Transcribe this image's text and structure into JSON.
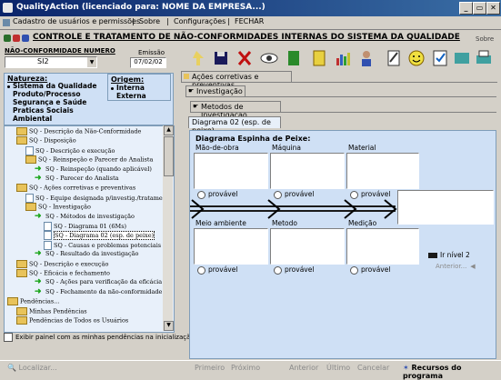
{
  "window": {
    "title": "QualityAction   (licenciado para: NOME DA EMPRESA...)",
    "controls": [
      "_",
      "▭",
      "✕"
    ]
  },
  "menubar": {
    "items": [
      "Cadastro de usuários e permissões",
      "Sobre",
      "Configurações",
      "FECHAR"
    ],
    "separators": [
      "|",
      "|",
      "|"
    ]
  },
  "banner": {
    "title": "CONTROLE E TRATAMENTO DE NÃO-CONFORMIDADES INTERNAS DO SISTEMA DA QUALIDADE",
    "sobre": "Sobre"
  },
  "nc": {
    "label": "NÃO-CONFORMIDADE  NUMERO",
    "number": "SI2",
    "emissao_label": "Emissão",
    "emissao_value": "07/02/02"
  },
  "natureza": {
    "label": "Natureza:",
    "options": [
      "Sistema da Qualidade",
      "Produto/Processo",
      "Segurança e Saúde",
      "Praticas Sociais",
      "Ambiental"
    ],
    "selected": "Sistema da Qualidade"
  },
  "origem": {
    "label": "Origem:",
    "options": [
      "Interna",
      "Externa"
    ],
    "selected": "Interna"
  },
  "tree": {
    "items": [
      {
        "text": "SQ - Descrição da Não-Conformidade",
        "kind": "folder",
        "indent": 1
      },
      {
        "text": "SQ - Disposição",
        "kind": "folder",
        "indent": 1
      },
      {
        "text": "SQ - Descrição e execução",
        "kind": "doc",
        "indent": 2
      },
      {
        "text": "SQ - Reinspeção e Parecer do Analista",
        "kind": "folder",
        "indent": 2
      },
      {
        "text": "SQ - Reinspeção (quando aplicável)",
        "kind": "arrow",
        "indent": 3
      },
      {
        "text": "SQ - Parecer do Analista",
        "kind": "arrow",
        "indent": 3
      },
      {
        "text": "SQ - Ações corretivas e preventivas",
        "kind": "folder",
        "indent": 1
      },
      {
        "text": "SQ - Equipe designada p/investig./tratamento",
        "kind": "doc",
        "indent": 2
      },
      {
        "text": "SQ - Investigação",
        "kind": "folder",
        "indent": 2
      },
      {
        "text": "SQ - Métodos de investigação",
        "kind": "arrow",
        "indent": 3
      },
      {
        "text": "SQ - Diagrama 01 (6Ms)",
        "kind": "doc",
        "indent": 4
      },
      {
        "text": "SQ - Diagrama 02 (esp. de peixe)",
        "kind": "doc",
        "indent": 4
      },
      {
        "text": "SQ - Causas e problemas potenciais",
        "kind": "doc",
        "indent": 4
      },
      {
        "text": "SQ - Resultado da investigação",
        "kind": "arrow",
        "indent": 3
      },
      {
        "text": "SQ - Descrição e execução",
        "kind": "folder",
        "indent": 1
      },
      {
        "text": "SQ - Eficácia e fechamento",
        "kind": "folder",
        "indent": 1
      },
      {
        "text": "SQ - Ações para verificação da eficácia",
        "kind": "arrow",
        "indent": 3
      },
      {
        "text": "SQ - Fechamento da não-conformidade",
        "kind": "arrow",
        "indent": 3
      },
      {
        "text": "Pendências...",
        "kind": "folder",
        "indent": 0
      },
      {
        "text": "Minhas Pendências",
        "kind": "folder",
        "indent": 1
      },
      {
        "text": "Pendências de Todos os Usuários",
        "kind": "folder",
        "indent": 1
      }
    ]
  },
  "exibir_painel": "Exibir painel com as minhas pendências na inicialização",
  "tabs": {
    "level1": "Ações corretivas e preventivas",
    "level2": "Investigação",
    "level3": "Metodos de Investigação",
    "level4": "Diagrama 02 (esp. de peixe)"
  },
  "diagram": {
    "title": "Diagrama Espinha de Peixe:",
    "top_labels": [
      "Mão-de-obra",
      "Máquina",
      "Material"
    ],
    "bottom_labels": [
      "Meio ambiente",
      "Metodo",
      "Medição"
    ],
    "provavel": "provável",
    "ir_nivel": "Ir nível 2",
    "anterior": "Anterior..."
  },
  "statusbar": {
    "localizar": "Localizar...",
    "primeiro": "Primeiro",
    "proximo": "Próximo",
    "anterior": "Anterior",
    "ultimo": "Último",
    "cancelar": "Cancelar",
    "recursos": "Recursos do programa"
  },
  "colors": {
    "title_bar": "#0a246a",
    "panel_blue": "#cfe0f5",
    "window_bg": "#d4d0c8"
  }
}
